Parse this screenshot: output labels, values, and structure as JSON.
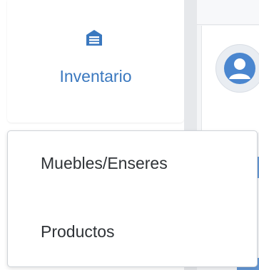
{
  "sidebar": {
    "active_item": {
      "label": "Inventario",
      "icon": "warehouse-icon",
      "color": "#3a78bf"
    }
  },
  "dropdown": {
    "items": [
      {
        "label": "Muebles/Enseres"
      },
      {
        "label": "Productos"
      }
    ]
  },
  "header": {
    "avatar_icon": "user-avatar-icon"
  },
  "colors": {
    "accent": "#3a78bf",
    "text": "#2f3337",
    "border": "#cfd3d8"
  }
}
